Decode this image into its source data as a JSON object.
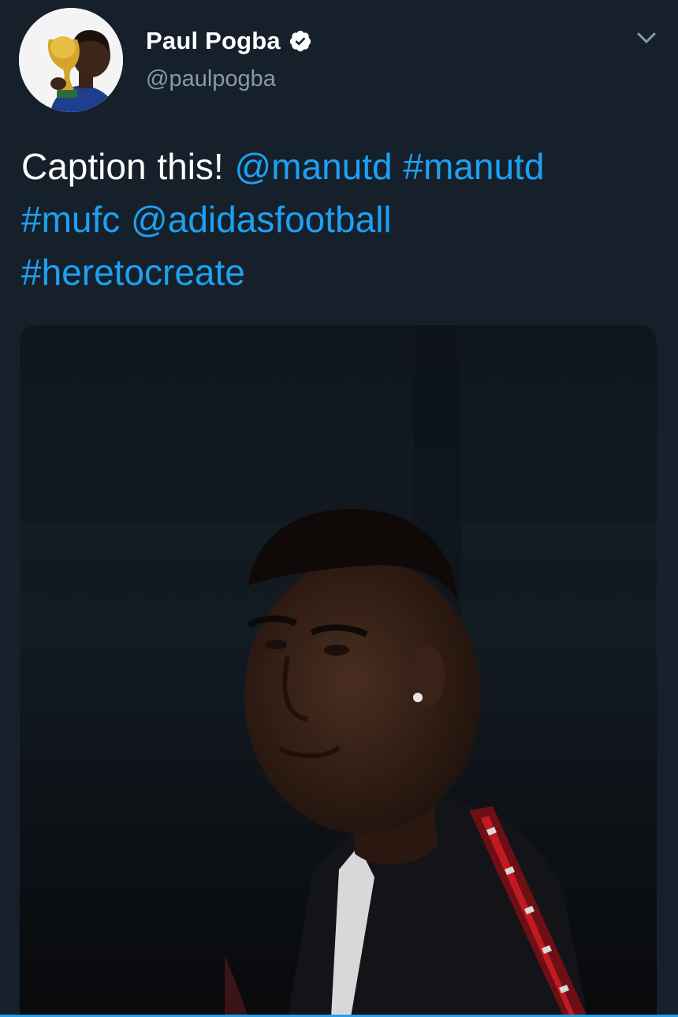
{
  "tweet": {
    "author": {
      "display_name": "Paul Pogba",
      "handle": "@paulpogba",
      "verified": true
    },
    "text_segments": [
      {
        "text": "Caption this! ",
        "type": "text"
      },
      {
        "text": "@manutd",
        "type": "mention"
      },
      {
        "text": " ",
        "type": "text"
      },
      {
        "text": "#manutd",
        "type": "hashtag"
      },
      {
        "text": " ",
        "type": "text"
      },
      {
        "text": "#mufc",
        "type": "hashtag"
      },
      {
        "text": " ",
        "type": "text"
      },
      {
        "text": "@adidasfootball",
        "type": "mention"
      },
      {
        "text": " ",
        "type": "text"
      },
      {
        "text": "#heretocreate",
        "type": "hashtag"
      }
    ]
  },
  "colors": {
    "background": "#15202b",
    "link": "#1da1f2",
    "secondary_text": "#8899a6",
    "primary_text": "#ffffff"
  },
  "icons": {
    "verified": "verified-badge-icon",
    "menu": "chevron-down-icon"
  }
}
